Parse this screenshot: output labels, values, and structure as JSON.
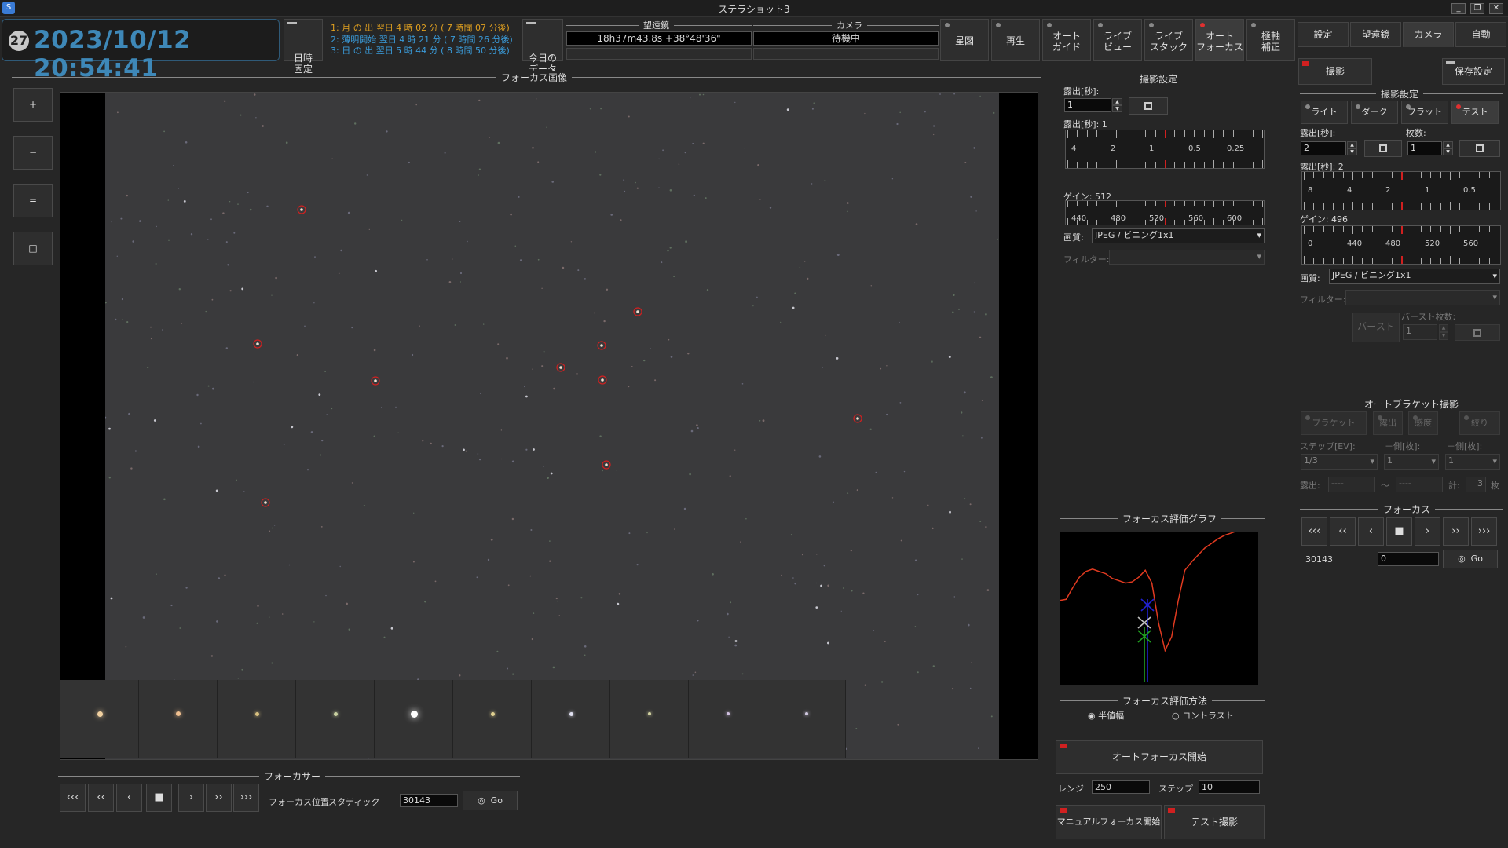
{
  "window": {
    "title": "ステラショット3",
    "app_icon_label": "S",
    "buttons": [
      "_",
      "❐",
      "✕"
    ]
  },
  "header": {
    "moon_age": "27",
    "datetime": "2023/10/12 20:54:41",
    "fix_button": "日時\n固定",
    "events": [
      {
        "text": "1: 月 の 出  翌日  4 時 02 分 ( 7 時間 07 分後)",
        "color": "#e0a020"
      },
      {
        "text": "2: 薄明開始 翌日  4 時 21 分 ( 7 時間 26 分後)",
        "color": "#3a9ad8"
      },
      {
        "text": "3: 日 の 出  翌日  5 時 44 分 ( 8 時間 50 分後)",
        "color": "#3a9ad8"
      }
    ],
    "today_data_button": "今日の\nデータ",
    "telescope": {
      "label": "望遠鏡",
      "value": "18h37m43.8s +38°48'36\""
    },
    "camera": {
      "label": "カメラ",
      "value": "待機中"
    },
    "tool_buttons": [
      {
        "label": "星図",
        "indicator": "led"
      },
      {
        "label": "再生",
        "indicator": "led"
      },
      {
        "label": "オート\nガイド",
        "indicator": "led"
      },
      {
        "label": "ライブ\nビュー",
        "indicator": "led"
      },
      {
        "label": "ライブ\nスタック",
        "indicator": "led"
      },
      {
        "label": "オート\nフォーカス",
        "indicator": "red",
        "active": true
      },
      {
        "label": "極軸\n補正",
        "indicator": "led"
      }
    ]
  },
  "right_tabs": [
    "設定",
    "望遠鏡",
    "カメラ",
    "自動"
  ],
  "right_tabs_selected": 2,
  "focus_image": {
    "section_title": "フォーカス画像",
    "zoom_buttons": [
      "+",
      "−",
      "=",
      "□"
    ],
    "selected_stars": [
      [
        1,
        1
      ],
      [
        2,
        2
      ]
    ],
    "star_count": 10,
    "thumbnails": 10
  },
  "focuser": {
    "section_title": "フォーカサー",
    "nav_buttons": [
      "‹‹‹",
      "‹‹",
      "‹",
      "■",
      "›",
      "››",
      "›››"
    ],
    "position_label": "フォーカス位置",
    "mode_label": "スタティック",
    "position_value": "30143",
    "go_label": "Go"
  },
  "capture_settings": {
    "section_title": "撮影設定",
    "exposure_label": "露出[秒]:",
    "exposure_value": "1",
    "exposure_slider_label": "露出[秒]: 1",
    "exposure_ticks": [
      "4",
      "2",
      "1",
      "0.5",
      "0.25"
    ],
    "gain_label": "ゲイン: 512",
    "gain_ticks": [
      "440",
      "480",
      "520",
      "560",
      "600"
    ],
    "quality_label": "画質:",
    "quality_value": "JPEG / ビニング1x1",
    "filter_label": "フィルター:",
    "filter_value": ""
  },
  "focus_graph": {
    "section_title": "フォーカス評価グラフ",
    "curve": [
      0.73,
      0.74,
      0.84,
      0.93,
      0.98,
      1.0,
      0.98,
      0.96,
      0.92,
      0.9,
      0.88,
      0.89,
      0.93,
      0.99,
      0.88,
      0.54,
      0.3,
      0.42,
      0.73,
      0.99,
      1.06,
      1.12,
      1.18,
      1.22,
      1.26,
      1.29,
      1.31,
      1.33,
      1.35,
      1.38,
      1.4
    ]
  },
  "focus_method": {
    "section_title": "フォーカス評価方法",
    "options": [
      "半値幅",
      "コントラスト"
    ],
    "selected": 0
  },
  "af_controls": {
    "start_button": "オートフォーカス開始",
    "range_label": "レンジ",
    "range_value": "250",
    "step_label": "ステップ",
    "step_value": "10",
    "manual_button": "マニュアルフォーカス開始",
    "test_button": "テスト撮影"
  },
  "camera_panel": {
    "shoot_button": "撮影",
    "save_settings_button": "保存設定",
    "settings_title": "撮影設定",
    "frame_types": [
      "ライト",
      "ダーク",
      "フラット",
      "テスト"
    ],
    "frame_selected": 3,
    "exposure_label": "露出[秒]:",
    "exposure_value": "2",
    "count_label": "枚数:",
    "count_value": "1",
    "exposure_slider_label": "露出[秒]: 2",
    "exposure_ticks": [
      "8",
      "4",
      "2",
      "1",
      "0.5"
    ],
    "gain_label": "ゲイン: 496",
    "gain_ticks": [
      "0",
      "440",
      "480",
      "520",
      "560"
    ],
    "quality_label": "画質:",
    "quality_value": "JPEG / ビニング1x1",
    "filter_label": "フィルター:",
    "burst_button": "バースト",
    "burst_count_label": "バースト枚数:",
    "burst_count_value": "1",
    "bracket_title": "オートブラケット撮影",
    "bracket_buttons": [
      "ブラケット",
      "露出",
      "感度",
      "絞り"
    ],
    "step_ev_label": "ステップ[EV]:",
    "step_ev_value": "1/3",
    "minus_label": "－側[枚]:",
    "minus_value": "1",
    "plus_label": "＋側[枚]:",
    "plus_value": "1",
    "exposure2_label": "露出:",
    "exposure2_from": "----",
    "tilde": "〜",
    "exposure2_to": "----",
    "total_label": "計:",
    "total_value": "3",
    "total_unit": "枚",
    "focus_title": "フォーカス",
    "focus_nav": [
      "‹‹‹",
      "‹‹",
      "‹",
      "■",
      "›",
      "››",
      "›››"
    ],
    "focus_position": "30143",
    "focus_input": "0",
    "go_label": "Go"
  }
}
